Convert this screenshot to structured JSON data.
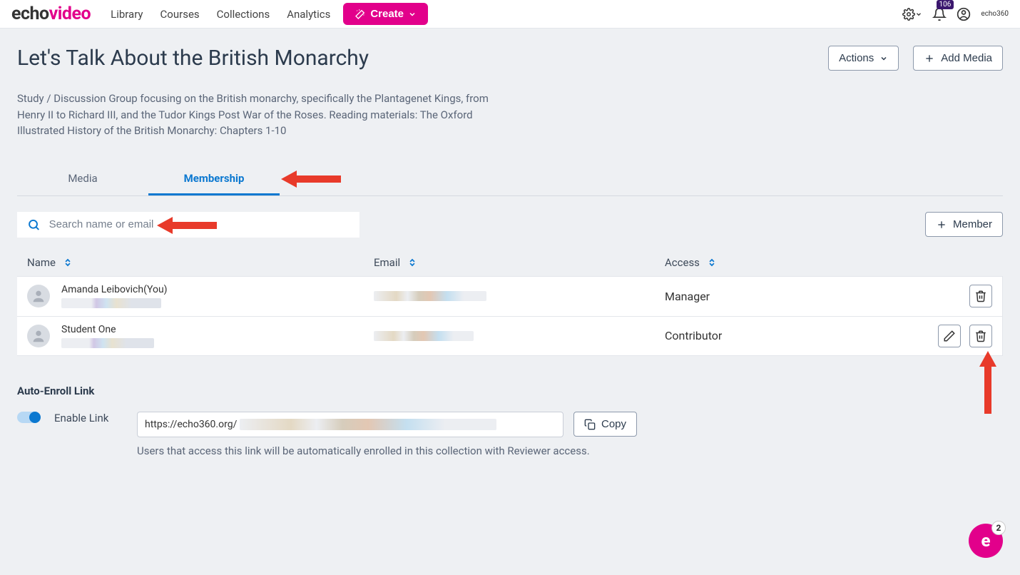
{
  "brand": {
    "part1": "echo",
    "part2": "video"
  },
  "nav": {
    "library": "Library",
    "courses": "Courses",
    "collections": "Collections",
    "analytics": "Analytics"
  },
  "create_label": "Create",
  "notif_count": "106",
  "page_title": "Let's Talk About the British Monarchy",
  "actions_label": "Actions",
  "add_media_label": "Add Media",
  "description": "Study / Discussion Group focusing on the British monarchy, specifically the Plantagenet Kings, from Henry II to Richard III, and the Tudor Kings Post War of the Roses. Reading materials: The Oxford Illustrated History of the British Monarchy: Chapters 1-10",
  "tabs": {
    "media": "Media",
    "membership": "Membership"
  },
  "search_placeholder": "Search name or email",
  "member_btn": "Member",
  "columns": {
    "name": "Name",
    "email": "Email",
    "access": "Access"
  },
  "members": [
    {
      "name": "Amanda Leibovich(You)",
      "access": "Manager",
      "editable": false
    },
    {
      "name": "Student One",
      "access": "Contributor",
      "editable": true
    }
  ],
  "auto_enroll": {
    "title": "Auto-Enroll Link",
    "enable_label": "Enable Link",
    "url_prefix": "https://echo360.org/",
    "copy_label": "Copy",
    "hint": "Users that access this link will be automatically enrolled in this collection with Reviewer access."
  },
  "fab_badge": "2",
  "mini_logo": "echo360"
}
